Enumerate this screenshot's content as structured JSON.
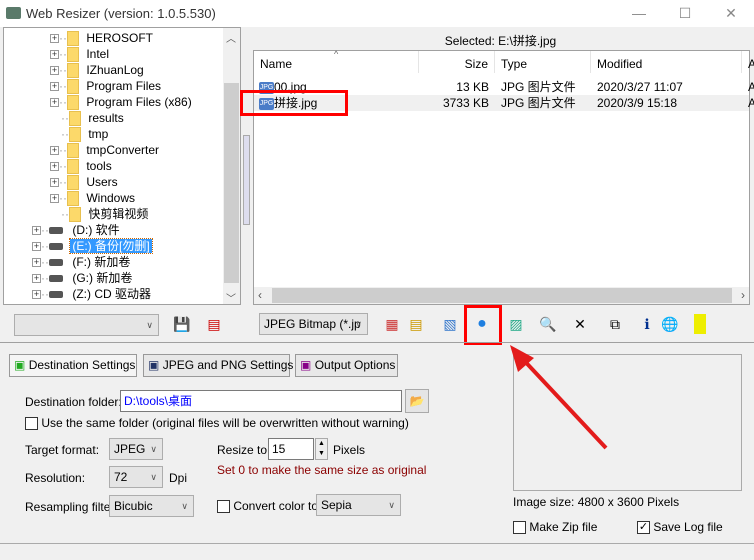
{
  "window": {
    "title": "Web Resizer (version: 1.0.5.530)",
    "minimize": "—",
    "maximize": "☐",
    "close": "✕"
  },
  "tree": {
    "folders": [
      "HEROSOFT",
      "Intel",
      "IZhuanLog",
      "Program Files",
      "Program Files (x86)",
      "results",
      "tmp",
      "tmpConverter",
      "tools",
      "Users",
      "Windows",
      "快剪辑视频"
    ],
    "folder_expandable": [
      true,
      true,
      true,
      true,
      true,
      false,
      false,
      true,
      true,
      true,
      true,
      false
    ],
    "drives": [
      "(D:) 软件",
      "(E:) 备份[勿删]",
      "(F:) 新加卷",
      "(G:) 新加卷",
      "(Z:) CD 驱动器"
    ],
    "selected_drive": "(E:) 备份[勿删]"
  },
  "selected_label": "Selected: E:\\拼接.jpg",
  "file_list": {
    "columns": [
      "Name",
      "Size",
      "Type",
      "Modified",
      "Attr"
    ],
    "rows": [
      {
        "name": "00.jpg",
        "size": "13 KB",
        "type": "JPG 图片文件",
        "modified": "2020/3/27 11:07",
        "attr": "A"
      },
      {
        "name": "拼接.jpg",
        "size": "3733 KB",
        "type": "JPG 图片文件",
        "modified": "2020/3/9 15:18",
        "attr": "A"
      }
    ]
  },
  "toolbar": {
    "profile_value": "",
    "format_value": "JPEG Bitmap (*.jp"
  },
  "tabs": [
    "Destination Settings",
    "JPEG and PNG Settings",
    "Output Options"
  ],
  "settings": {
    "dest_label": "Destination folder:",
    "dest_value": "D:\\tools\\桌面",
    "same_folder_label": "Use the same folder (original files will be overwritten without warning)",
    "target_format_label": "Target format:",
    "target_format_value": "JPEG",
    "resolution_label": "Resolution:",
    "resolution_value": "72",
    "dpi": "Dpi",
    "resampling_label": "Resampling filter:",
    "resampling_value": "Bicubic",
    "resize_label": "Resize to:",
    "resize_value": "15",
    "pixels": "Pixels",
    "hint": "Set 0 to make the same size as original",
    "convert_label": "Convert color to:",
    "convert_value": "Sepia"
  },
  "preview": {
    "image_size": "Image size: 4800 x 3600 Pixels",
    "zip_label": "Make Zip file",
    "log_label": "Save Log file",
    "log_checked": true
  },
  "colors": {
    "highlight": "#ff0000",
    "selection": "#3399ff",
    "hint": "#8b0000",
    "dest_text": "#0000ff"
  }
}
